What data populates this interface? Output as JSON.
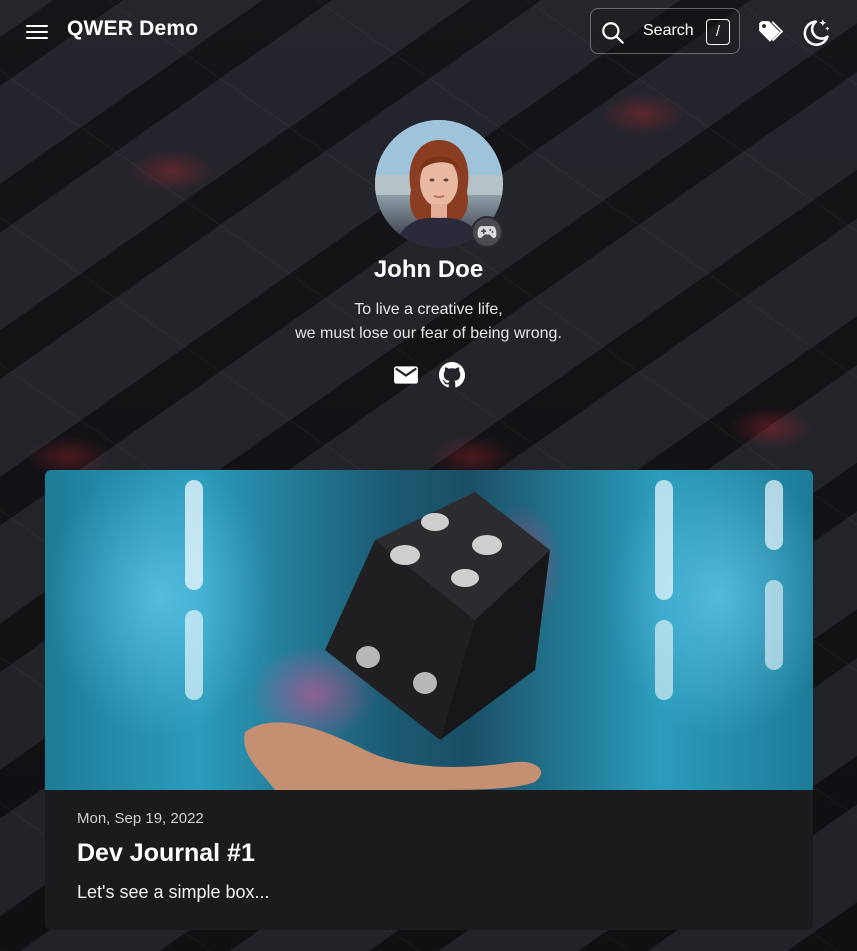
{
  "header": {
    "site_title": "QWER Demo",
    "search_label": "Search",
    "search_shortcut": "/"
  },
  "icons": {
    "menu": "hamburger-menu-icon",
    "search": "search-icon",
    "tags": "tag-icon",
    "theme": "moon-stars-icon",
    "status": "gamepad-icon",
    "email": "email-icon",
    "github": "github-icon"
  },
  "profile": {
    "name": "John Doe",
    "bio_line1": "To live a creative life,",
    "bio_line2": "we must lose our fear of being wrong."
  },
  "posts": [
    {
      "date": "Mon, Sep 19, 2022",
      "title": "Dev Journal #1",
      "excerpt": "Let's see a simple box..."
    }
  ],
  "colors": {
    "card_background": "#1b1b1e",
    "page_background": "#1a1a1f",
    "accent_red": "#c82832"
  }
}
